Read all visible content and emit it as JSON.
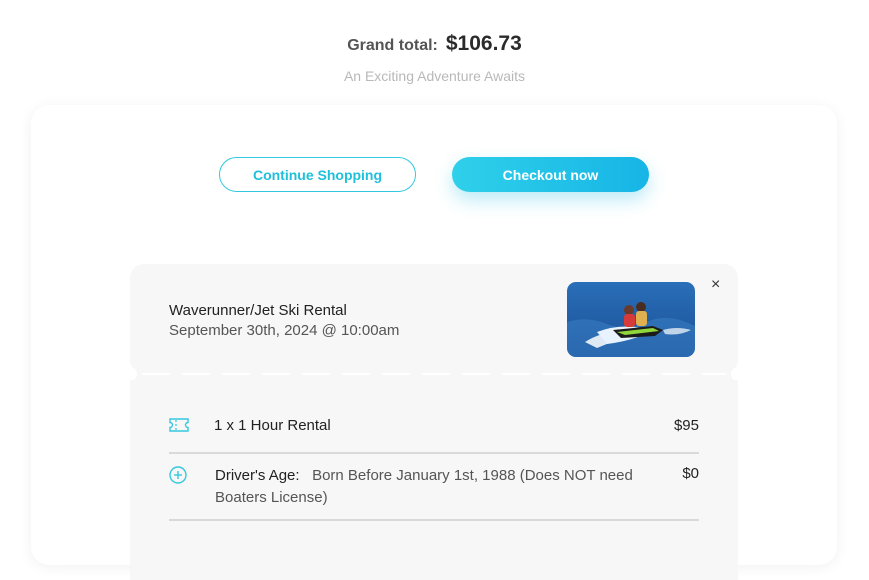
{
  "summary": {
    "grand_total_label": "Grand total:",
    "grand_total_value": "$106.73",
    "tagline": "An Exciting Adventure Awaits"
  },
  "actions": {
    "continue_label": "Continue Shopping",
    "checkout_label": "Checkout now"
  },
  "cart_item": {
    "title": "Waverunner/Jet Ski Rental",
    "date": "September 30th, 2024 @ 10:00am",
    "close_glyph": "×",
    "image_alt": "Jet ski riders on water"
  },
  "line_items": [
    {
      "icon": "ticket-icon",
      "label": "1 x 1 Hour Rental",
      "price": "$95"
    },
    {
      "icon": "plus-circle-icon",
      "key": "Driver's Age:",
      "value": "Born Before January 1st, 1988 (Does NOT need Boaters License)",
      "price": "$0"
    }
  ],
  "colors": {
    "accent": "#1fc0dc",
    "panel_bg": "#f7f7f7"
  }
}
